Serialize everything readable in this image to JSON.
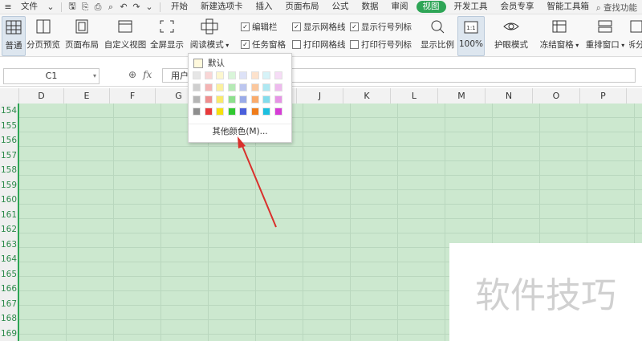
{
  "menubar": {
    "file_label": "文件",
    "tabs": [
      "开始",
      "新建选项卡",
      "插入",
      "页面布局",
      "公式",
      "数据",
      "审阅",
      "视图",
      "开发工具",
      "会员专享",
      "智能工具箱"
    ],
    "active_tab": "视图",
    "search_label": "查找功能"
  },
  "ribbon": {
    "buttons": [
      "普通",
      "分页预览",
      "页面布局",
      "自定义视图",
      "全屏显示",
      "阅读模式"
    ],
    "reading_mode_label": "阅读模式",
    "checks": [
      {
        "label": "编辑栏",
        "checked": true
      },
      {
        "label": "任务窗格",
        "checked": true
      },
      {
        "label": "显示网格线",
        "checked": true
      },
      {
        "label": "打印网格线",
        "checked": false
      },
      {
        "label": "显示行号列标",
        "checked": true
      },
      {
        "label": "打印行号列标",
        "checked": false
      }
    ],
    "display_ratio_label": "显示比例",
    "zoom_label": "100%",
    "eye_mode_label": "护眼模式",
    "freeze_label": "冻结窗格",
    "rearrange_label": "重排窗口",
    "split_label": "拆分"
  },
  "formula_bar": {
    "name_box": "C1",
    "fx": "fx",
    "value": "用户"
  },
  "columns": [
    "D",
    "E",
    "F",
    "G",
    "H",
    "I",
    "J",
    "K",
    "L",
    "M",
    "N",
    "O",
    "P"
  ],
  "rows": [
    "154",
    "155",
    "156",
    "157",
    "158",
    "159",
    "160",
    "161",
    "162",
    "163",
    "164",
    "165",
    "166",
    "167",
    "168",
    "169"
  ],
  "dropdown": {
    "default_label": "默认",
    "more_label": "其他颜色(M)...",
    "swatch_rows": [
      [
        "#e6e6e6",
        "#f9d6d6",
        "#fdf7cf",
        "#d9f5d9",
        "#dde2f7",
        "#fde2cc",
        "#d6f3f8",
        "#f6dcf6"
      ],
      [
        "#cfcfcf",
        "#f4b4b4",
        "#fbf09f",
        "#b5eab5",
        "#bcc6ef",
        "#fbc79d",
        "#aee8f2",
        "#eebaee"
      ],
      [
        "#b5b5b5",
        "#ee8f8f",
        "#f9e96b",
        "#8de08d",
        "#9aabe8",
        "#f9ab6c",
        "#83dcec",
        "#e694e6"
      ],
      [
        "#8e8e8e",
        "#e8393a",
        "#f6e00d",
        "#31c931",
        "#4a5fdb",
        "#ef7c1a",
        "#1dbfdf",
        "#d63cd6"
      ]
    ]
  },
  "watermark": "软件技巧"
}
